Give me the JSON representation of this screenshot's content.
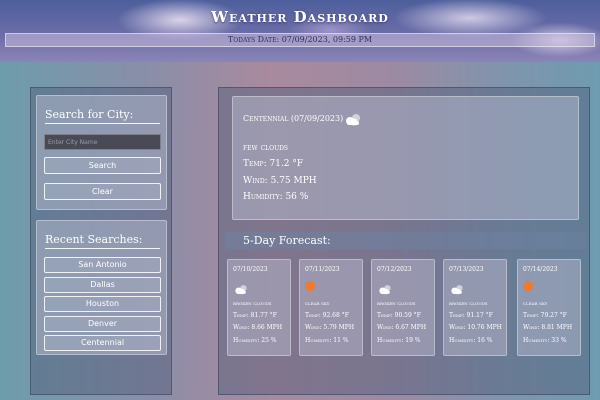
{
  "header": {
    "title": "Weather Dashboard",
    "date_text": "Todays Date: 07/09/2023, 09:59 PM"
  },
  "search": {
    "heading": "Search for City:",
    "placeholder": "Enter City Name",
    "search_label": "Search",
    "clear_label": "Clear"
  },
  "recent": {
    "heading": "Recent Searches:",
    "items": [
      {
        "label": "San Antonio"
      },
      {
        "label": "Dallas"
      },
      {
        "label": "Houston"
      },
      {
        "label": "Denver"
      },
      {
        "label": "Centennial"
      }
    ]
  },
  "current": {
    "title": "Centennial (07/09/2023)",
    "icon": "cloud-icon",
    "description": "few clouds",
    "temp": "Temp: 71.2 °F",
    "wind": "Wind: 5.75 MPH",
    "humidity": "Humidity: 56 %"
  },
  "forecast": {
    "heading": "5-Day Forecast:",
    "days": [
      {
        "date": "07/10/2023",
        "icon": "cloud-icon",
        "desc": "broken clouds",
        "temp": "Temp: 81.77 °F",
        "wind": "Wind: 8.66 MPH",
        "humidity": "Humidity: 25 %"
      },
      {
        "date": "07/11/2023",
        "icon": "sun-icon",
        "desc": "clear sky",
        "temp": "Temp: 92.68 °F",
        "wind": "Wind: 5.79 MPH",
        "humidity": "Humidity: 11 %"
      },
      {
        "date": "07/12/2023",
        "icon": "cloud-icon",
        "desc": "broken clouds",
        "temp": "Temp: 90.59 °F",
        "wind": "Wind: 6.67 MPH",
        "humidity": "Humidity: 19 %"
      },
      {
        "date": "07/13/2023",
        "icon": "cloud-icon",
        "desc": "broken clouds",
        "temp": "Temp: 91.17 °F",
        "wind": "Wind: 10.76 MPH",
        "humidity": "Humidity: 16 %"
      },
      {
        "date": "07/14/2023",
        "icon": "sun-icon",
        "desc": "clear sky",
        "temp": "Temp: 79.27 °F",
        "wind": "Wind: 8.81 MPH",
        "humidity": "Humidity: 33 %"
      }
    ]
  },
  "colors": {
    "sun": "#f07a2a",
    "header_bg": "#5c679f"
  }
}
